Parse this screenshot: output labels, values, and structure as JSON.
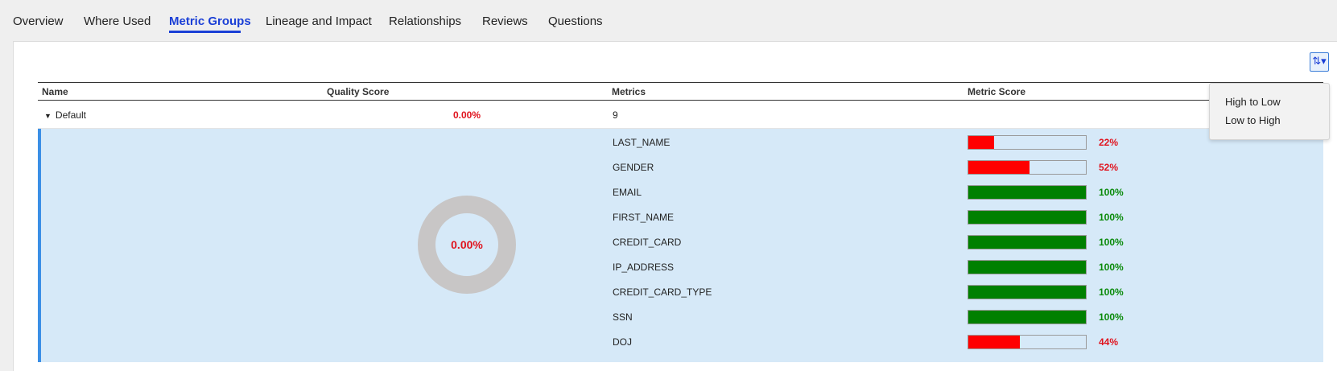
{
  "tabs": [
    {
      "label": "Overview",
      "active": false
    },
    {
      "label": "Where Used",
      "active": false
    },
    {
      "label": "Metric Groups",
      "active": true
    },
    {
      "label": "Lineage and Impact",
      "active": false
    },
    {
      "label": "Relationships",
      "active": false
    },
    {
      "label": "Reviews",
      "active": false
    },
    {
      "label": "Questions",
      "active": false
    }
  ],
  "sort_menu": {
    "icon": "sort-icon",
    "items": [
      "High to Low",
      "Low to High"
    ]
  },
  "table": {
    "headers": {
      "name": "Name",
      "quality_score": "Quality Score",
      "metrics": "Metrics",
      "metric_score": "Metric Score"
    },
    "group": {
      "name": "Default",
      "quality_score": "0.00%",
      "metrics_count": "9",
      "donut_label": "0.00%"
    },
    "metrics": [
      {
        "name": "LAST_NAME",
        "score_pct": 22,
        "label": "22%"
      },
      {
        "name": "GENDER",
        "score_pct": 52,
        "label": "52%"
      },
      {
        "name": "EMAIL",
        "score_pct": 100,
        "label": "100%"
      },
      {
        "name": "FIRST_NAME",
        "score_pct": 100,
        "label": "100%"
      },
      {
        "name": "CREDIT_CARD",
        "score_pct": 100,
        "label": "100%"
      },
      {
        "name": "IP_ADDRESS",
        "score_pct": 100,
        "label": "100%"
      },
      {
        "name": "CREDIT_CARD_TYPE",
        "score_pct": 100,
        "label": "100%"
      },
      {
        "name": "SSN",
        "score_pct": 100,
        "label": "100%"
      },
      {
        "name": "DOJ",
        "score_pct": 44,
        "label": "44%"
      }
    ]
  },
  "colors": {
    "accent": "#1a3fd6",
    "bad": "#ff0000",
    "good": "#008000",
    "bad_text": "#e0141e",
    "good_text": "#0a8a0a",
    "donut_ring": "#c8c6c6"
  }
}
